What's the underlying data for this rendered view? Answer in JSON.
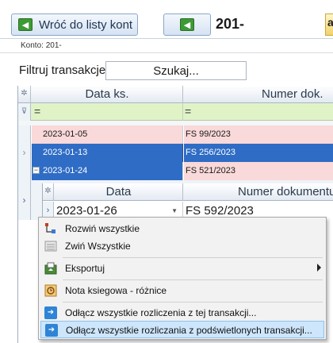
{
  "toolbar": {
    "back_label": "Wróć do listy kont",
    "account_number": "201-",
    "edge_text": "a"
  },
  "konto_label": "Konto: 201-",
  "filter": {
    "label": "Filtruj transakcje",
    "search_text": "Szukaj..."
  },
  "grid": {
    "columns": [
      "Data ks.",
      "Numer dok."
    ],
    "filter_ops": [
      "=",
      "="
    ],
    "rows": [
      {
        "date": "2023-01-05",
        "doc": "FS 99/2023"
      },
      {
        "date": "2023-01-13",
        "doc": "FS 256/2023"
      },
      {
        "date": "2023-01-24",
        "doc": "FS 521/2023"
      }
    ]
  },
  "detail": {
    "columns": [
      "Data",
      "Numer dokumentu"
    ],
    "row": {
      "date": "2023-01-26",
      "doc": "FS 592/2023"
    }
  },
  "context_menu": {
    "items": [
      {
        "label": "Rozwiń wszystkie",
        "icon": "expand-tree-icon"
      },
      {
        "label": "Zwiń Wszystkie",
        "icon": "collapse-tree-icon"
      },
      {
        "label": "Eksportuj",
        "icon": "export-icon"
      },
      {
        "label": "Nota ksiegowa - różnice",
        "icon": "note-icon"
      },
      {
        "label": "Odłącz wszystkie rozliczenia z tej transakcji...",
        "icon": "arrow-right-icon"
      },
      {
        "label": "Odłącz wszystkie rozliczania z podświetlonych transakcji...",
        "icon": "arrow-right-icon"
      }
    ]
  },
  "colors": {
    "selection": "#2f6cc5",
    "row_pink": "#f9d9d9",
    "filter_row": "#dff3c7",
    "menu_highlight": "#cde6fb"
  }
}
